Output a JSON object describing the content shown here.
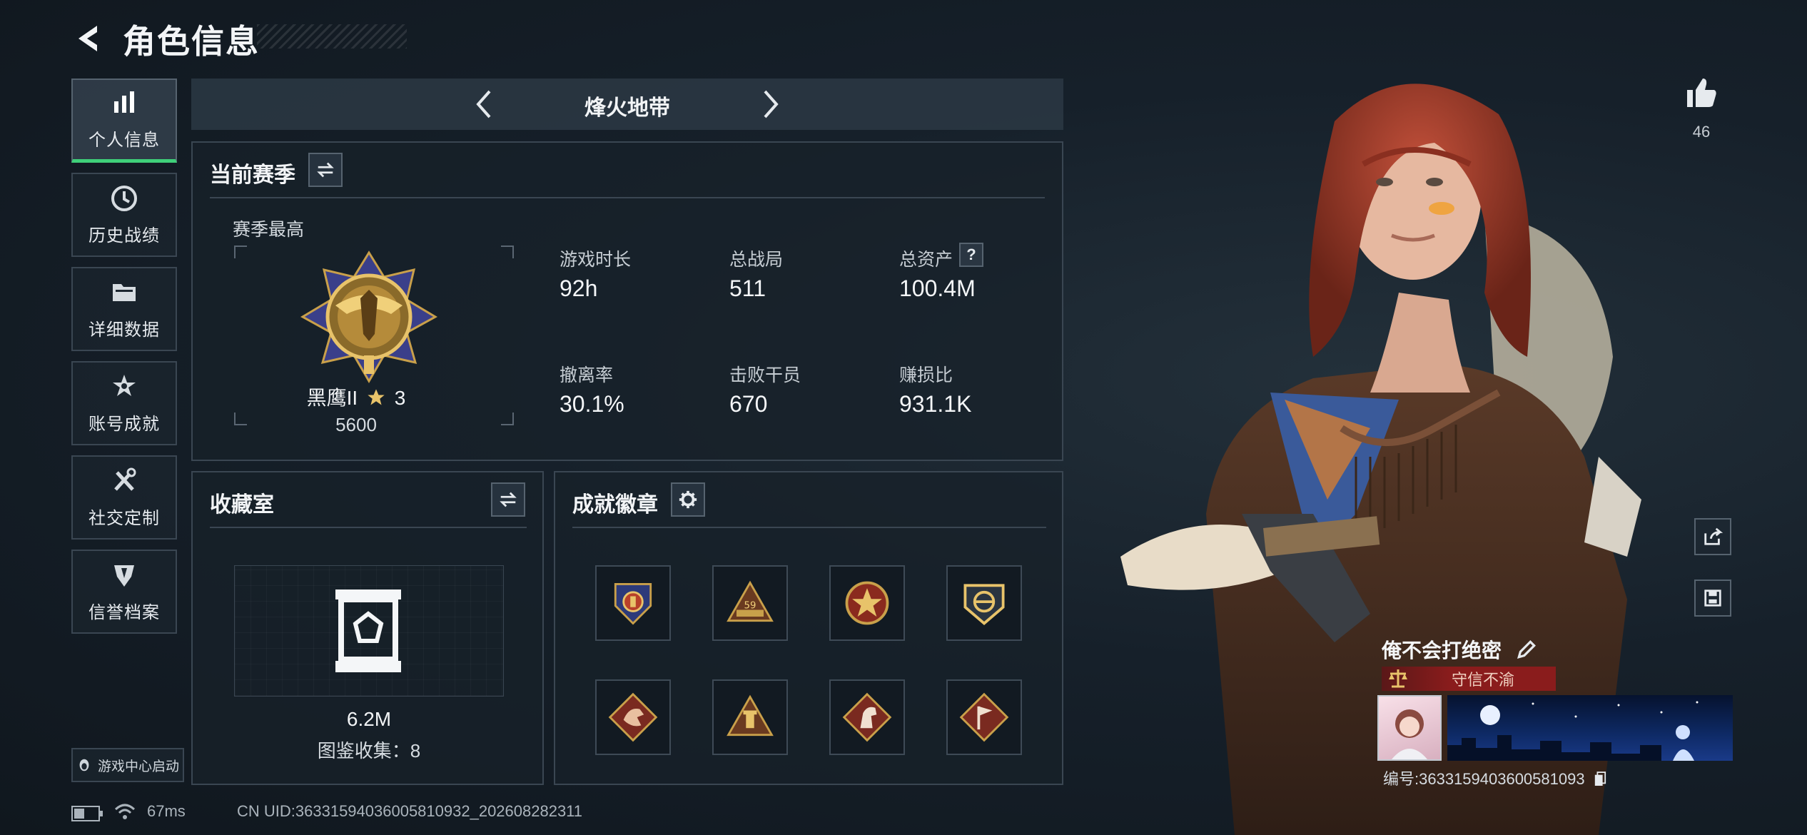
{
  "header": {
    "title": "角色信息",
    "back_icon": "chevron-left-icon"
  },
  "sidebar": {
    "items": [
      {
        "label": "个人信息",
        "icon": "bar-chart-icon",
        "active": true
      },
      {
        "label": "历史战绩",
        "icon": "clock-icon",
        "active": false
      },
      {
        "label": "详细数据",
        "icon": "folder-icon",
        "active": false
      },
      {
        "label": "账号成就",
        "icon": "star-emblem-icon",
        "active": false
      },
      {
        "label": "社交定制",
        "icon": "tools-icon",
        "active": false
      },
      {
        "label": "信誉档案",
        "icon": "shield-emblem-icon",
        "active": false
      }
    ],
    "launch_label": "游戏中心启动"
  },
  "mode_selector": {
    "name": "烽火地带"
  },
  "season": {
    "title": "当前赛季",
    "best_label": "赛季最高",
    "rank_name": "黑鹰II",
    "rank_stars": "3",
    "rank_points": "5600",
    "stats": [
      {
        "label": "游戏时长",
        "value": "92h"
      },
      {
        "label": "总战局",
        "value": "511"
      },
      {
        "label": "总资产",
        "value": "100.4M",
        "help": "?"
      },
      {
        "label": "撤离率",
        "value": "30.1%"
      },
      {
        "label": "击败干员",
        "value": "670"
      },
      {
        "label": "赚损比",
        "value": "931.1K"
      }
    ]
  },
  "collection": {
    "title": "收藏室",
    "value": "6.2M",
    "catalog_label": "图鉴收集：8"
  },
  "achievements": {
    "title": "成就徽章",
    "badges": [
      "badge-winged-shield-icon",
      "badge-triangle-59-icon",
      "badge-star-medal-icon",
      "badge-crest-icon",
      "badge-dragon-icon",
      "badge-tower-icon",
      "badge-horse-icon",
      "badge-flag-icon"
    ]
  },
  "player": {
    "likes": "46",
    "name": "俺不会打绝密",
    "title_badge": "守信不渝",
    "id_text": "编号:3633159403600581093"
  },
  "status_bar": {
    "ping": "67ms",
    "uid_text": "CN UID:3633159403600581093​2_202608282311"
  },
  "colors": {
    "accent": "#3fd07a",
    "panel_border": "#3a4652",
    "title_badge_bg": "#8a1c1c",
    "gold": "#c9a04a"
  }
}
